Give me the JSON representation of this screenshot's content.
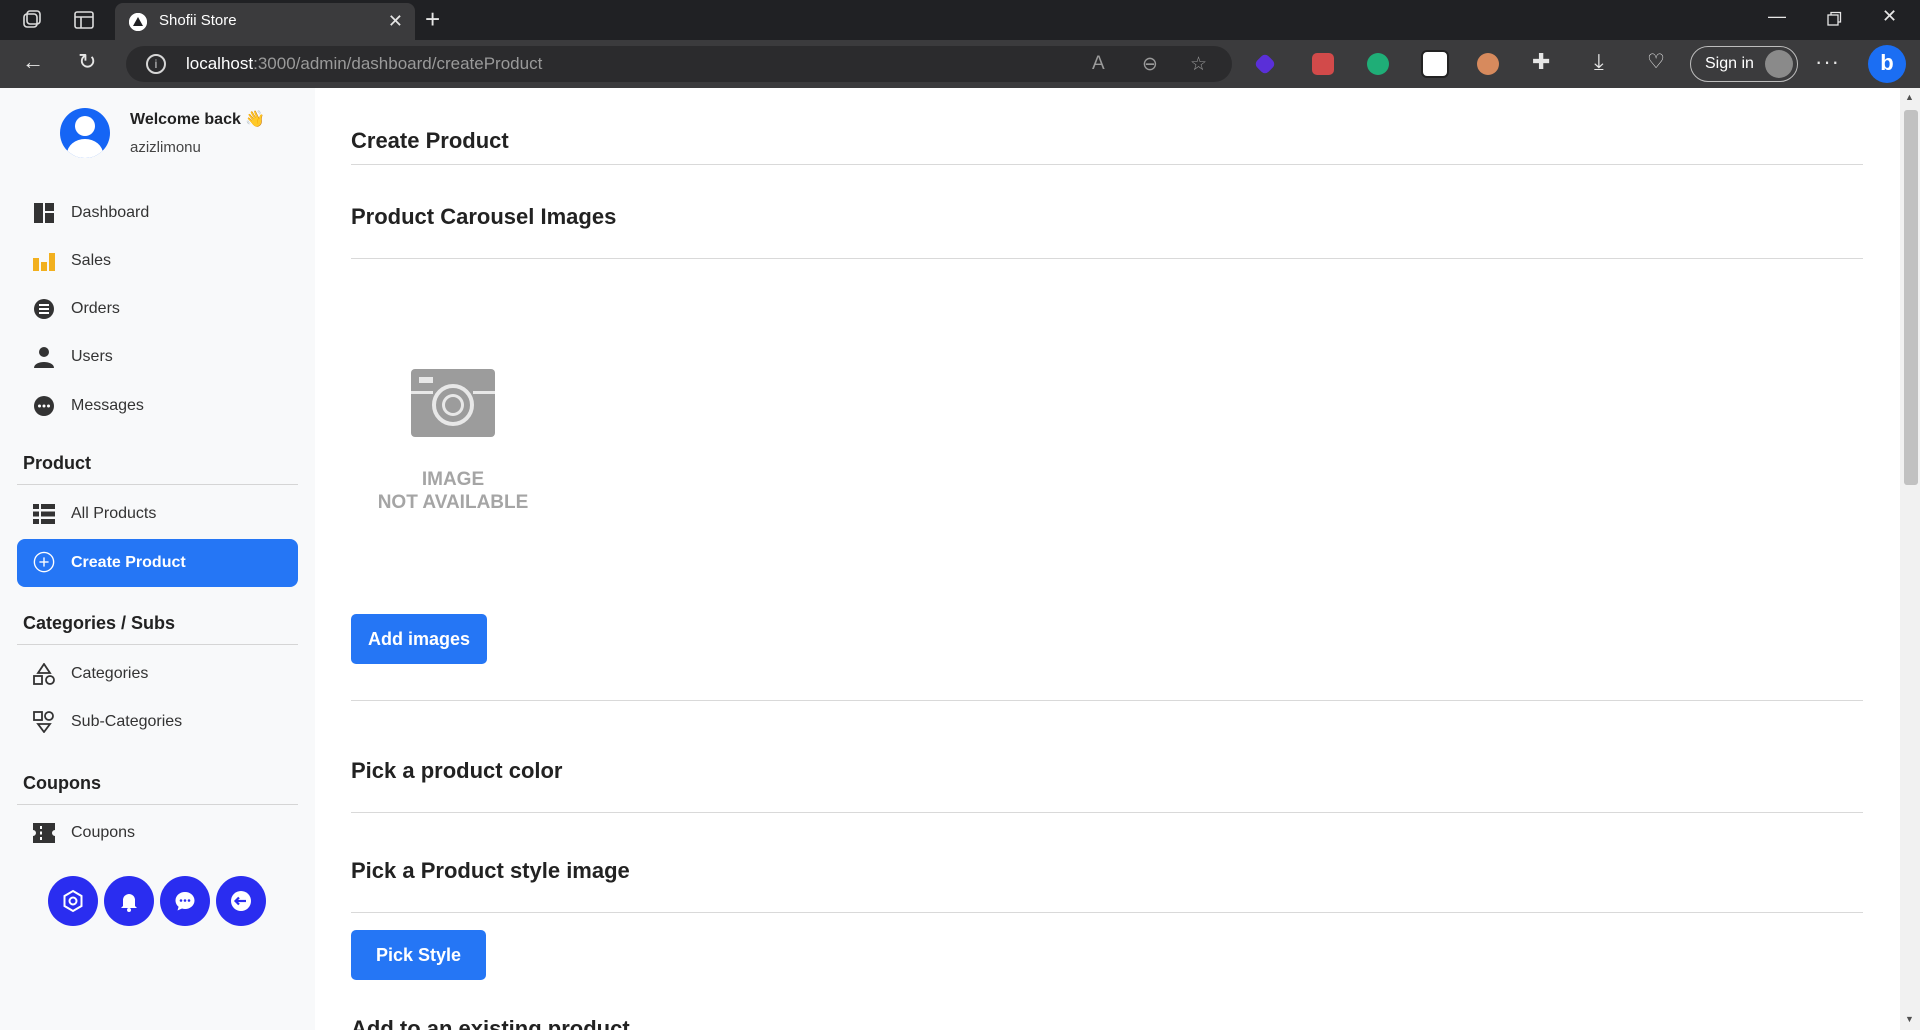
{
  "browser": {
    "tab_title": "Shofii Store",
    "url_host": "localhost",
    "url_path": ":3000/admin/dashboard/createProduct",
    "signin_label": "Sign in"
  },
  "sidebar": {
    "welcome": "Welcome back 👋",
    "username": "azizlimonu",
    "main_items": [
      {
        "label": "Dashboard",
        "icon": "dashboard-icon"
      },
      {
        "label": "Sales",
        "icon": "bar-chart-icon"
      },
      {
        "label": "Orders",
        "icon": "list-icon"
      },
      {
        "label": "Users",
        "icon": "user-icon"
      },
      {
        "label": "Messages",
        "icon": "chat-icon"
      }
    ],
    "sections": [
      {
        "title": "Product",
        "items": [
          {
            "label": "All Products",
            "icon": "table-icon"
          },
          {
            "label": "Create Product",
            "icon": "plus-circle-icon",
            "active": true
          }
        ]
      },
      {
        "title": "Categories / Subs",
        "items": [
          {
            "label": "Categories",
            "icon": "shapes-icon"
          },
          {
            "label": "Sub-Categories",
            "icon": "sub-shapes-icon"
          }
        ]
      },
      {
        "title": "Coupons",
        "items": [
          {
            "label": "Coupons",
            "icon": "ticket-icon"
          }
        ]
      }
    ],
    "footer_buttons": [
      "settings-icon",
      "bell-icon",
      "chat-bubble-icon",
      "logout-icon"
    ]
  },
  "main": {
    "page_title": "Create Product",
    "carousel_title": "Product Carousel Images",
    "placeholder_line1": "IMAGE",
    "placeholder_line2": "NOT AVAILABLE",
    "add_images_label": "Add images",
    "color_title": "Pick a product color",
    "style_title": "Pick a Product style image",
    "pick_style_label": "Pick Style",
    "existing_title": "Add to an existing product"
  },
  "colors": {
    "accent": "#2576f5",
    "round_buttons": "#2a2df0",
    "sidebar_bg": "#f8f9fa"
  }
}
